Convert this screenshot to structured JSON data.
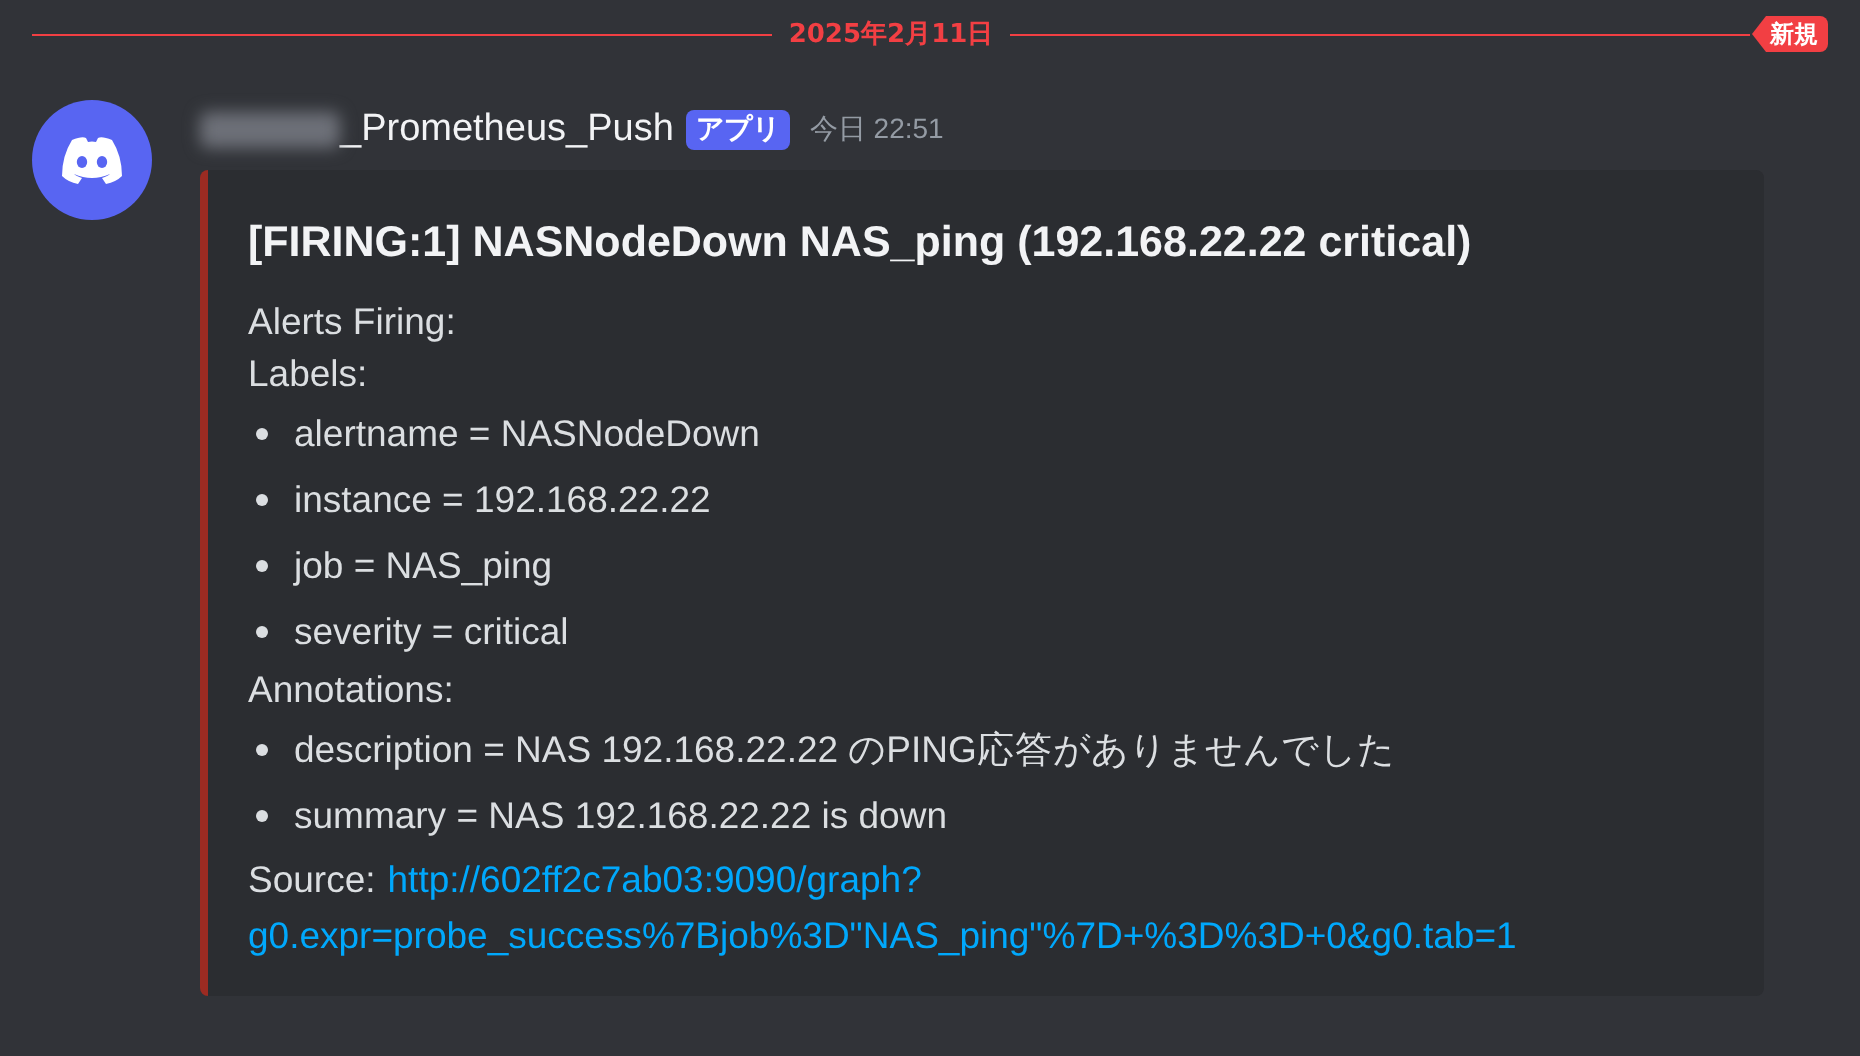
{
  "divider": {
    "date": "2025年2月11日",
    "badge": "新規"
  },
  "message": {
    "username": "_Prometheus_Push",
    "name_blurred": true,
    "app_badge": "アプリ",
    "timestamp": "今日 22:51",
    "embed": {
      "color": "#9c2b22",
      "title": "[FIRING:1] NASNodeDown NAS_ping (192.168.22.22 critical)",
      "sections": [
        {
          "kind": "text",
          "text": "Alerts Firing:"
        },
        {
          "kind": "text",
          "text": "Labels:"
        },
        {
          "kind": "bullets",
          "items": [
            "alertname = NASNodeDown",
            "instance = 192.168.22.22",
            "job = NAS_ping",
            "severity = critical"
          ]
        },
        {
          "kind": "text",
          "text": "Annotations:"
        },
        {
          "kind": "bullets",
          "items": [
            "description = NAS 192.168.22.22 のPING応答がありませんでした",
            "summary = NAS 192.168.22.22 is down"
          ]
        },
        {
          "kind": "source",
          "label": "Source:",
          "link_lines": [
            "http://602ff2c7ab03:9090/graph?",
            "g0.expr=probe_success%7Bjob%3D\"NAS_ping\"%7D+%3D%3D+0&g0.tab=1"
          ]
        }
      ]
    }
  }
}
